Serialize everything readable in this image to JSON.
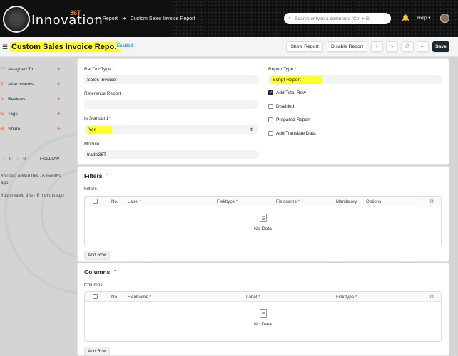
{
  "navbar": {
    "logo_text": "Innovation",
    "logo_badge": "36T",
    "breadcrumbs": [
      "Report",
      "Custom Sales Invoice Report"
    ],
    "search_placeholder": "Search or type a command (Ctrl + G)",
    "help_label": "Help"
  },
  "page": {
    "title": "Custom Sales Invoice Report",
    "status_badge": "Enabled",
    "buttons": {
      "show_report": "Show Report",
      "disable_report": "Disable Report",
      "prev": "‹",
      "next": "›",
      "more": "···",
      "save": "Save"
    }
  },
  "sidebar": {
    "items": [
      {
        "label": "Assigned To",
        "icon": "user-icon"
      },
      {
        "label": "Attachments",
        "icon": "paperclip-icon"
      },
      {
        "label": "Reviews",
        "icon": "comment-icon"
      },
      {
        "label": "Tags",
        "icon": "tag-icon"
      },
      {
        "label": "Share",
        "icon": "share-icon"
      }
    ],
    "likes": "0",
    "comments": "0",
    "follow_label": "FOLLOW",
    "last_edited": "You last edited this · 6 months ago",
    "created": "You created this · 6 months ago"
  },
  "form": {
    "ref_doctype_label": "Ref DocType",
    "ref_doctype_value": "Sales Invoice",
    "reference_report_label": "Reference Report",
    "reference_report_value": "",
    "is_standard_label": "Is Standard",
    "is_standard_value": "Yes",
    "module_label": "Module",
    "module_value": "trade36T",
    "report_type_label": "Report Type",
    "report_type_value": "Script Report",
    "checkboxes": [
      {
        "label": "Add Total Row",
        "checked": true
      },
      {
        "label": "Disabled",
        "checked": false
      },
      {
        "label": "Prepared Report",
        "checked": false
      },
      {
        "label": "Add Translate Data",
        "checked": false
      }
    ]
  },
  "filters": {
    "section_title": "Filters",
    "table_label": "Filters",
    "columns": [
      "No.",
      "Label",
      "Fieldtype",
      "Fieldname",
      "Mandatory",
      "Options"
    ],
    "empty_text": "No Data",
    "add_row": "Add Row"
  },
  "columns_section": {
    "section_title": "Columns",
    "table_label": "Columns",
    "columns": [
      "No.",
      "Fieldname",
      "Label",
      "Fieldtype"
    ],
    "empty_text": "No Data",
    "add_row": "Add Row"
  },
  "colors": {
    "highlight": "#ffff2b",
    "accent": "#e86a28",
    "primary_button": "#1f272e"
  }
}
